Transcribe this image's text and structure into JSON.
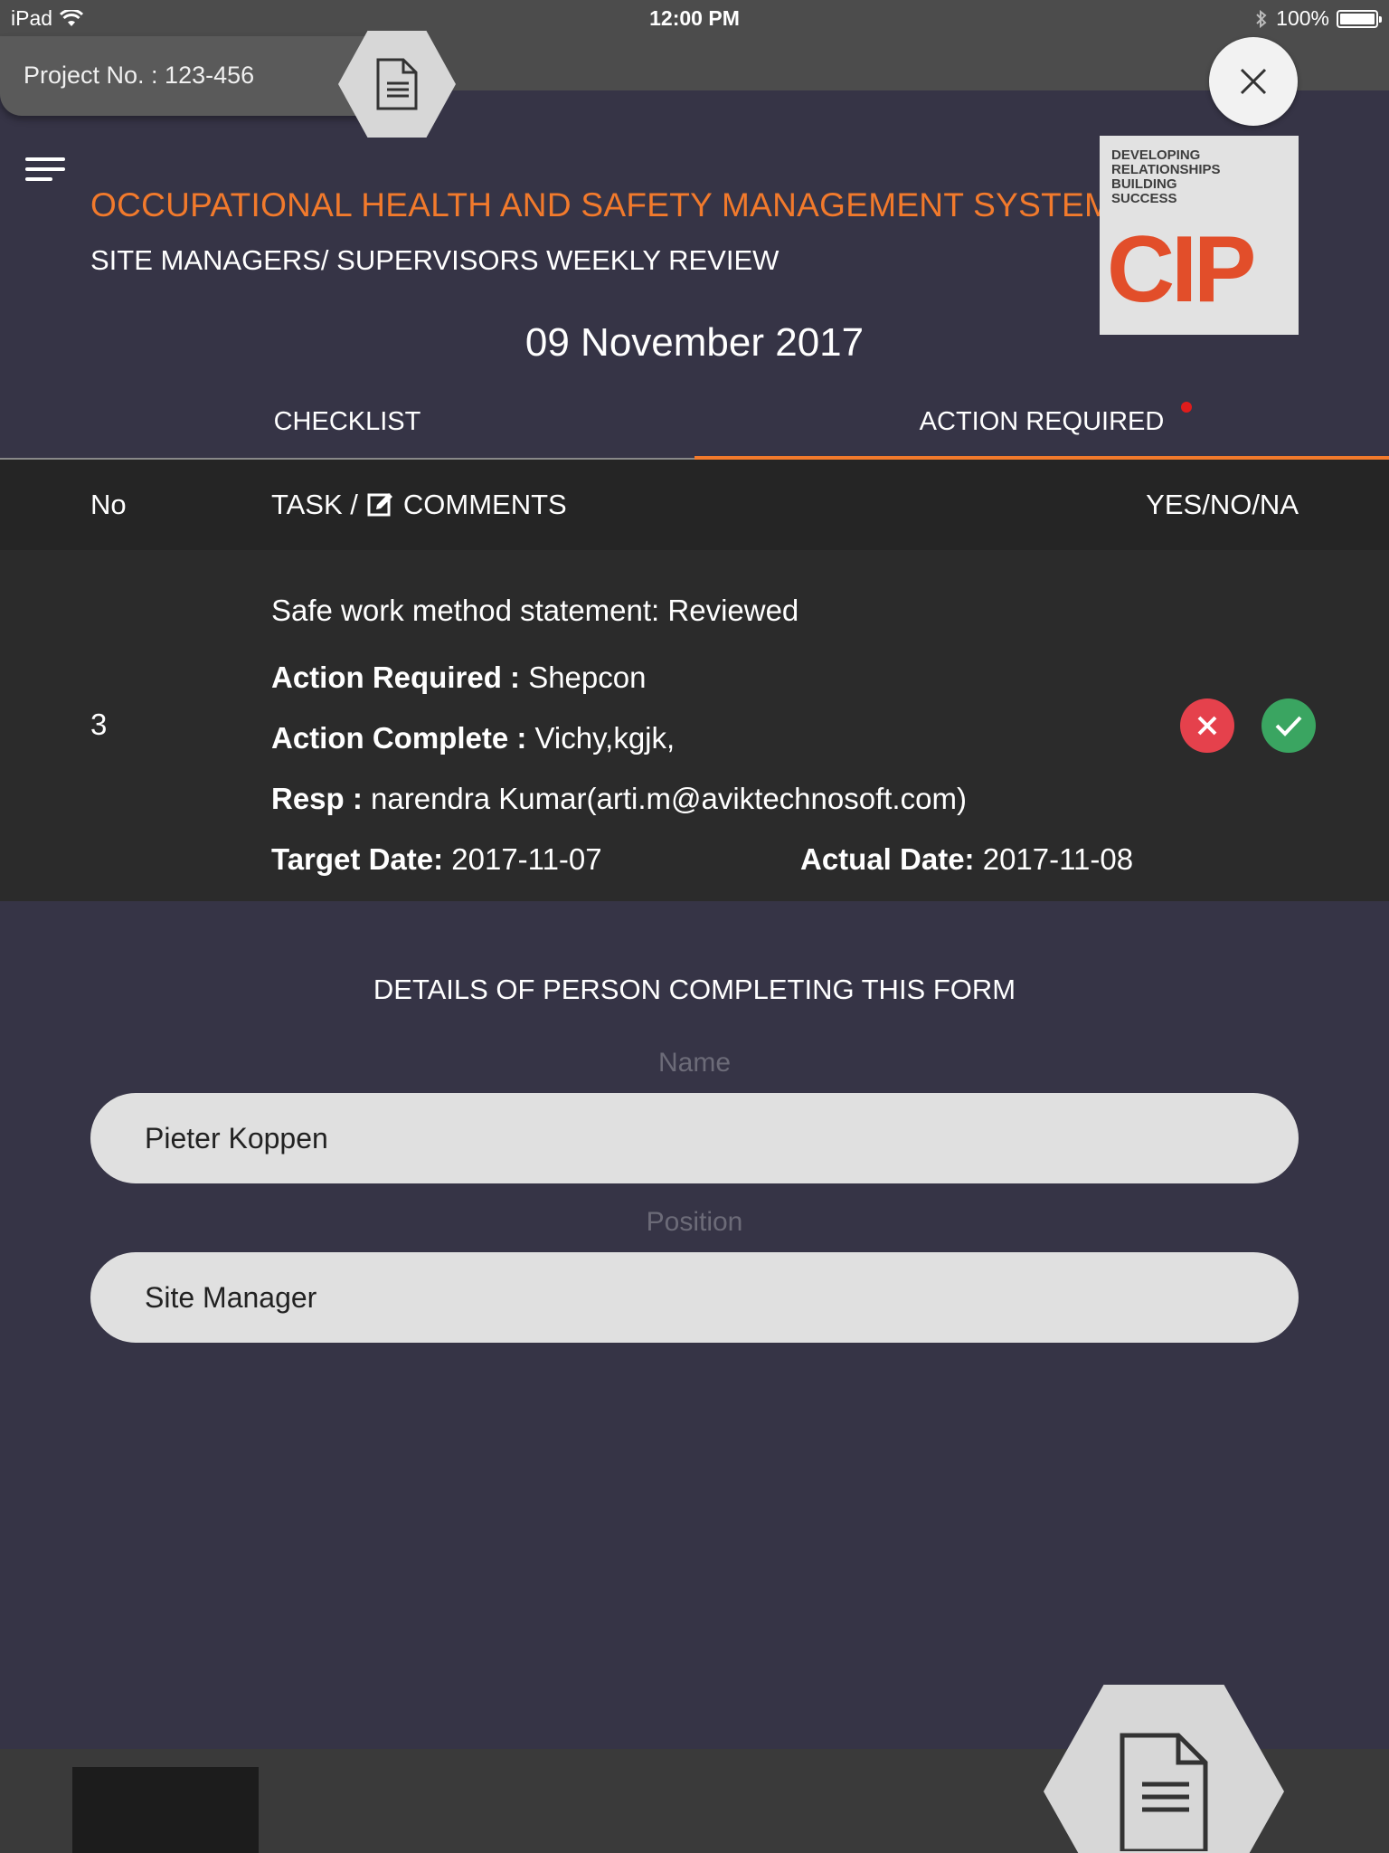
{
  "status_bar": {
    "device": "iPad",
    "time": "12:00 PM",
    "battery": "100%"
  },
  "project": {
    "label": "Project No. : 123-456"
  },
  "header": {
    "title": "OCCUPATIONAL HEALTH AND SAFETY MANAGEMENT SYSTEM",
    "subtitle": "SITE MANAGERS/ SUPERVISORS WEEKLY REVIEW",
    "date": "09 November 2017",
    "logo_tagline_1": "DEVELOPING",
    "logo_tagline_2": "RELATIONSHIPS",
    "logo_tagline_3": "BUILDING",
    "logo_tagline_4": "SUCCESS",
    "logo_brand": "CIP"
  },
  "tabs": [
    {
      "label": "CHECKLIST",
      "active": false
    },
    {
      "label": "ACTION REQUIRED",
      "active": true
    }
  ],
  "table": {
    "col_no": "No",
    "col_task_prefix": "TASK /",
    "col_task_suffix": "COMMENTS",
    "col_yes_no": "YES/NO/NA",
    "rows": [
      {
        "no": "3",
        "task": "Safe work method statement: Reviewed",
        "action_required_label": "Action Required :",
        "action_required_value": "Shepcon",
        "action_complete_label": "Action Complete :",
        "action_complete_value": "Vichy,kgjk,",
        "resp_label": "Resp :",
        "resp_value": "narendra Kumar(arti.m@aviktechnosoft.com)",
        "target_date_label": "Target Date:",
        "target_date_value": "2017-11-07",
        "actual_date_label": "Actual Date:",
        "actual_date_value": "2017-11-08"
      }
    ]
  },
  "form": {
    "section_title": "DETAILS OF PERSON COMPLETING THIS FORM",
    "name_label": "Name",
    "name_value": "Pieter Koppen",
    "position_label": "Position",
    "position_value": "Site Manager"
  },
  "colors": {
    "accent": "#f27a2c",
    "background": "#363446",
    "no_button": "#e5414c",
    "yes_button": "#3aa561"
  }
}
